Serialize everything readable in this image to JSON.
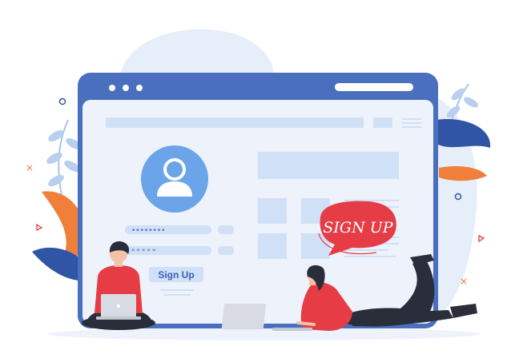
{
  "form": {
    "password_mask": "••••••••",
    "pin_mask": "* * * * *",
    "signup_button_label": "Sign Up"
  },
  "speech_bubble": {
    "text": "SIGN UP"
  },
  "colors": {
    "browser_frame": "#4a6fbf",
    "browser_panel": "#eef2fb",
    "placeholder_block": "#cfe0f7",
    "avatar_circle": "#6ba4e8",
    "button_fill": "#cfe0f7",
    "button_text": "#3a5fb8",
    "bubble_red": "#e63c45",
    "leaf_blue": "#2f55a4",
    "leaf_orange": "#f07f3c",
    "blob_bg": "#e6eef9"
  }
}
